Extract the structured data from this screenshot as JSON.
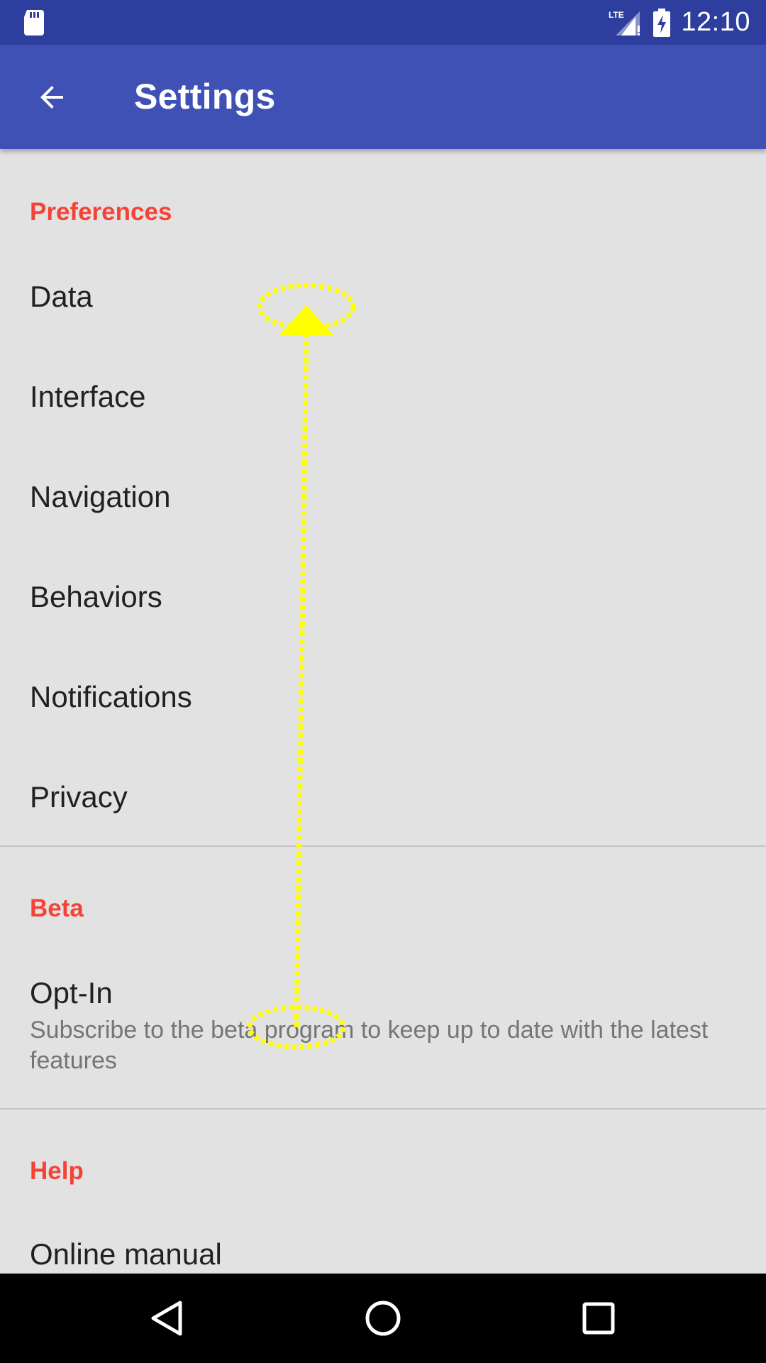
{
  "status_bar": {
    "network_label": "LTE",
    "time": "12:10",
    "icons": [
      "sd-card-icon",
      "lte-signal-icon",
      "battery-charging-icon"
    ]
  },
  "app_bar": {
    "title": "Settings",
    "back_icon": "arrow-back-icon"
  },
  "sections": [
    {
      "title": "Preferences",
      "items": [
        {
          "title": "Data"
        },
        {
          "title": "Interface"
        },
        {
          "title": "Navigation"
        },
        {
          "title": "Behaviors"
        },
        {
          "title": "Notifications"
        },
        {
          "title": "Privacy"
        }
      ]
    },
    {
      "title": "Beta",
      "items": [
        {
          "title": "Opt-In",
          "summary": "Subscribe to the beta program to keep up to date with the latest features"
        }
      ]
    },
    {
      "title": "Help",
      "items": [
        {
          "title": "Online manual"
        }
      ]
    }
  ],
  "gesture": {
    "type": "swipe-up",
    "color": "#ffff00"
  },
  "nav_bar": {
    "icons": [
      "back-triangle-icon",
      "home-circle-icon",
      "recents-square-icon"
    ]
  },
  "colors": {
    "status_bar": "#2e3e9f",
    "app_bar": "#3f51b5",
    "accent": "#f44336",
    "background": "#e2e2e2"
  }
}
